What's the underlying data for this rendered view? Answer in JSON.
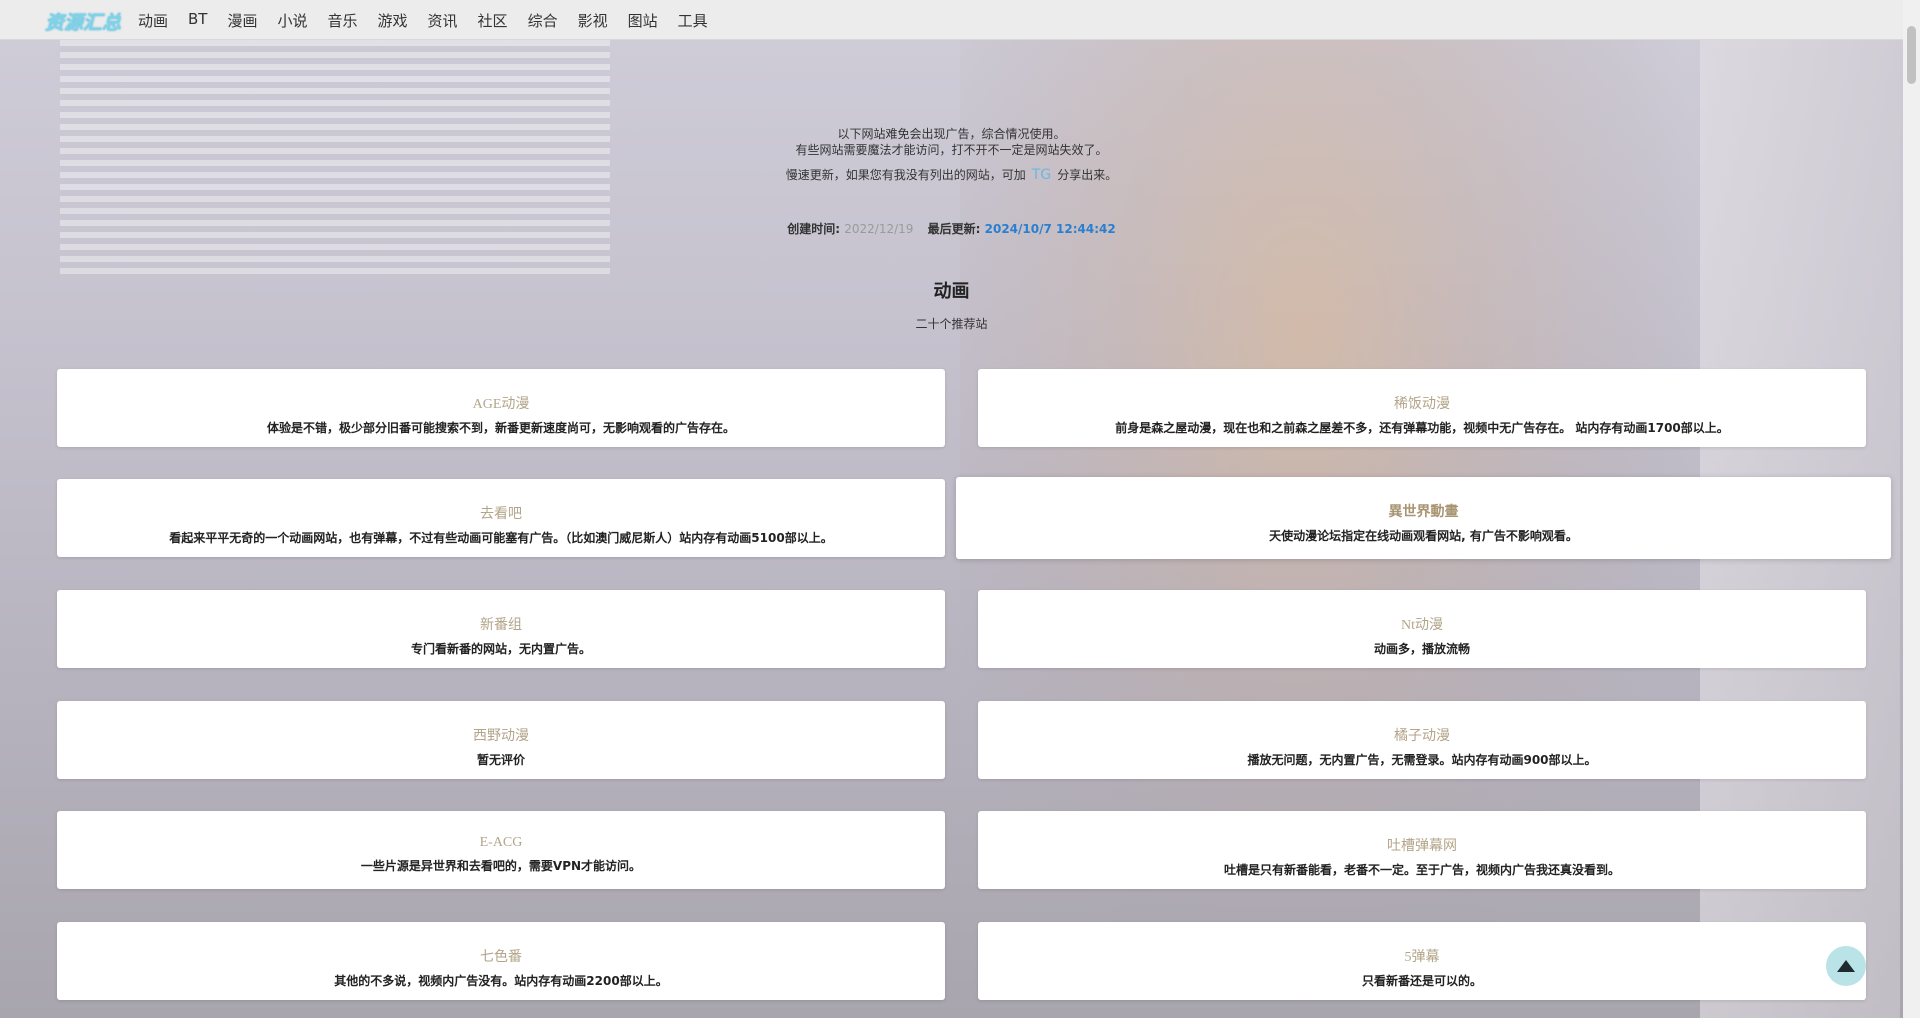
{
  "brand": "资源汇总",
  "nav": [
    "动画",
    "BT",
    "漫画",
    "小说",
    "音乐",
    "游戏",
    "资讯",
    "社区",
    "综合",
    "影视",
    "图站",
    "工具"
  ],
  "notice": {
    "line1": "以下网站难免会出现广告，综合情况使用。",
    "line2": "有些网站需要魔法才能访问，打不开不一定是网站失效了。",
    "update_prefix": "慢速更新，如果您有我没有列出的网站，可加",
    "tg_label": "TG",
    "update_suffix": "分享出来。"
  },
  "meta": {
    "created_label": "创建时间:",
    "created_value": "2022/12/19",
    "updated_label": "最后更新:",
    "updated_value": "2024/10/7 12:44:42"
  },
  "section": {
    "title": "动画",
    "subtitle": "二十个推荐站"
  },
  "cards": [
    {
      "title": "AGE动漫",
      "desc": "体验是不错，极少部分旧番可能搜索不到，新番更新速度尚可，无影响观看的广告存在。"
    },
    {
      "title": "稀饭动漫",
      "desc": "前身是森之屋动漫，现在也和之前森之屋差不多，还有弹幕功能，视频中无广告存在。 站内存有动画1700部以上。"
    },
    {
      "title": "去看吧",
      "desc": "看起来平平无奇的一个动画网站，也有弹幕，不过有些动画可能塞有广告。（比如澳门威尼斯人）站内存有动画5100部以上。"
    },
    {
      "title": "異世界動畫",
      "desc": "天使动漫论坛指定在线动画观看网站, 有广告不影响观看。"
    },
    {
      "title": "新番组",
      "desc": "专门看新番的网站，无内置广告。"
    },
    {
      "title": "Nt动漫",
      "desc": "动画多，播放流畅"
    },
    {
      "title": "西野动漫",
      "desc": "暂无评价"
    },
    {
      "title": "橘子动漫",
      "desc": "播放无问题，无内置广告，无需登录。站内存有动画900部以上。"
    },
    {
      "title": "E-ACG",
      "desc": "一些片源是异世界和去看吧的，需要VPN才能访问。"
    },
    {
      "title": "吐槽弹幕网",
      "desc": "吐槽是只有新番能看，老番不一定。至于广告，视频内广告我还真没看到。"
    },
    {
      "title": "七色番",
      "desc": "其他的不多说，视频内广告没有。站内存有动画2200部以上。"
    },
    {
      "title": "5弹幕",
      "desc": "只看新番还是可以的。"
    }
  ],
  "back_to_top_icon": "arrow-up-icon"
}
